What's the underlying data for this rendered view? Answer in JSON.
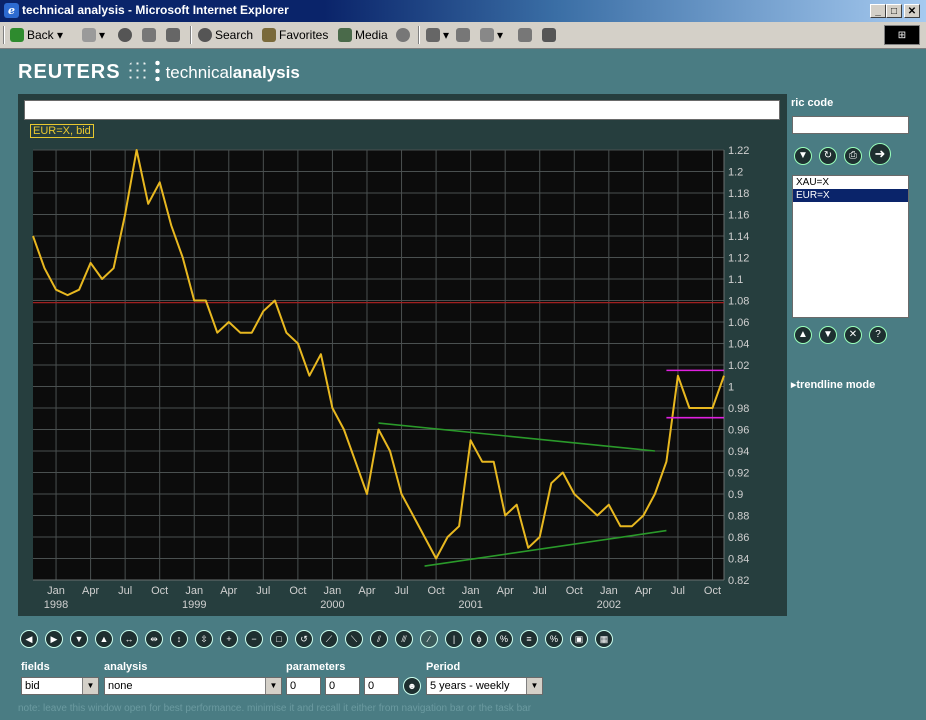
{
  "window": {
    "title": "technical analysis - Microsoft Internet Explorer",
    "min": "_",
    "max": "□",
    "close": "✕"
  },
  "toolbar": {
    "back": "Back",
    "search": "Search",
    "favorites": "Favorites",
    "media": "Media"
  },
  "brand": {
    "reuters": "REUTERS",
    "technical": "technical",
    "analysis": "analysis"
  },
  "chart": {
    "series_tag": "EUR=X, bid"
  },
  "chart_data": {
    "type": "line",
    "series": [
      {
        "name": "EUR=X, bid",
        "color": "#e8b820"
      }
    ],
    "x": [
      "1997-11",
      "1997-12",
      "1998-01",
      "1998-02",
      "1998-03",
      "1998-04",
      "1998-05",
      "1998-06",
      "1998-07",
      "1998-08",
      "1998-09",
      "1998-10",
      "1998-11",
      "1998-12",
      "1999-01",
      "1999-02",
      "1999-03",
      "1999-04",
      "1999-05",
      "1999-06",
      "1999-07",
      "1999-08",
      "1999-09",
      "1999-10",
      "1999-11",
      "1999-12",
      "2000-01",
      "2000-02",
      "2000-03",
      "2000-04",
      "2000-05",
      "2000-06",
      "2000-07",
      "2000-08",
      "2000-09",
      "2000-10",
      "2000-11",
      "2000-12",
      "2001-01",
      "2001-02",
      "2001-03",
      "2001-04",
      "2001-05",
      "2001-06",
      "2001-07",
      "2001-08",
      "2001-09",
      "2001-10",
      "2001-11",
      "2001-12",
      "2002-01",
      "2002-02",
      "2002-03",
      "2002-04",
      "2002-05",
      "2002-06",
      "2002-07",
      "2002-08",
      "2002-09",
      "2002-10",
      "2002-11"
    ],
    "values": [
      1.14,
      1.11,
      1.09,
      1.085,
      1.09,
      1.115,
      1.1,
      1.11,
      1.16,
      1.22,
      1.17,
      1.19,
      1.15,
      1.12,
      1.08,
      1.08,
      1.05,
      1.06,
      1.05,
      1.05,
      1.07,
      1.08,
      1.05,
      1.04,
      1.01,
      1.03,
      0.98,
      0.96,
      0.93,
      0.9,
      0.96,
      0.94,
      0.9,
      0.88,
      0.86,
      0.84,
      0.86,
      0.87,
      0.95,
      0.93,
      0.93,
      0.88,
      0.89,
      0.85,
      0.86,
      0.91,
      0.92,
      0.9,
      0.89,
      0.88,
      0.89,
      0.87,
      0.87,
      0.88,
      0.9,
      0.93,
      1.01,
      0.98,
      0.98,
      0.98,
      1.01
    ],
    "xlim": [
      "1997-11",
      "2002-11"
    ],
    "ylim": [
      0.82,
      1.22
    ],
    "yticks": [
      0.82,
      0.84,
      0.86,
      0.88,
      0.9,
      0.92,
      0.94,
      0.96,
      0.98,
      1.0,
      1.02,
      1.04,
      1.06,
      1.08,
      1.1,
      1.12,
      1.14,
      1.16,
      1.18,
      1.2,
      1.22
    ],
    "ytick_labels": [
      "0.82",
      "0.84",
      "0.86",
      "0.88",
      "0.9",
      "0.92",
      "0.94",
      "0.96",
      "0.98",
      "1",
      "1.02",
      "1.04",
      "1.06",
      "1.08",
      "1.1",
      "1.12",
      "1.14",
      "1.16",
      "1.18",
      "1.2",
      "1.22"
    ],
    "xticks": [
      {
        "label": "Jan",
        "year": "1998",
        "date": "1998-01"
      },
      {
        "label": "Apr",
        "date": "1998-04"
      },
      {
        "label": "Jul",
        "date": "1998-07"
      },
      {
        "label": "Oct",
        "date": "1998-10"
      },
      {
        "label": "Jan",
        "year": "1999",
        "date": "1999-01"
      },
      {
        "label": "Apr",
        "date": "1999-04"
      },
      {
        "label": "Jul",
        "date": "1999-07"
      },
      {
        "label": "Oct",
        "date": "1999-10"
      },
      {
        "label": "Jan",
        "year": "2000",
        "date": "2000-01"
      },
      {
        "label": "Apr",
        "date": "2000-04"
      },
      {
        "label": "Jul",
        "date": "2000-07"
      },
      {
        "label": "Oct",
        "date": "2000-10"
      },
      {
        "label": "Jan",
        "year": "2001",
        "date": "2001-01"
      },
      {
        "label": "Apr",
        "date": "2001-04"
      },
      {
        "label": "Jul",
        "date": "2001-07"
      },
      {
        "label": "Oct",
        "date": "2001-10"
      },
      {
        "label": "Jan",
        "year": "2002",
        "date": "2002-01"
      },
      {
        "label": "Apr",
        "date": "2002-04"
      },
      {
        "label": "Jul",
        "date": "2002-07"
      },
      {
        "label": "Oct",
        "date": "2002-10"
      }
    ],
    "hlines": [
      {
        "y": 1.078,
        "color": "#a02020"
      }
    ],
    "trendlines": [
      {
        "x": [
          "2000-05",
          "2002-05"
        ],
        "y": [
          0.966,
          0.94
        ],
        "color": "#2a9a2a"
      },
      {
        "x": [
          "2000-09",
          "2002-06"
        ],
        "y": [
          0.833,
          0.866
        ],
        "color": "#2a9a2a"
      },
      {
        "x": [
          "2002-06",
          "2002-11"
        ],
        "y": [
          1.015,
          1.015
        ],
        "color": "#e020e0"
      },
      {
        "x": [
          "2002-06",
          "2002-11"
        ],
        "y": [
          0.971,
          0.971
        ],
        "color": "#e020e0"
      }
    ],
    "grid": true,
    "xlabel": "",
    "ylabel": ""
  },
  "side": {
    "ric_label": "ric code",
    "ric_value": "",
    "list": [
      "XAU=X",
      "EUR=X"
    ],
    "selected": 1,
    "trendline_mode": "trendline mode"
  },
  "controls": {
    "fields_label": "fields",
    "fields_value": "bid",
    "analysis_label": "analysis",
    "analysis_value": "none",
    "parameters_label": "parameters",
    "param1": "0",
    "param2": "0",
    "param3": "0",
    "period_label": "Period",
    "period_value": "5 years - weekly"
  },
  "footer": "note: leave this window open for best performance. minimise it and recall it either from navigation bar or the task bar"
}
